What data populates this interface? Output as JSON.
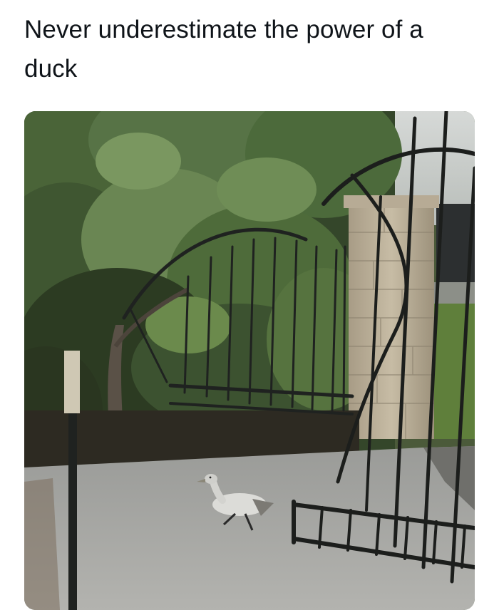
{
  "post": {
    "caption": "Never underestimate the power of a duck"
  },
  "photo": {
    "subject": "duck-walking-past-bent-gate",
    "colors": {
      "sky": "#c9ccc9",
      "foliage_dark": "#2f3f26",
      "foliage_mid": "#4f6a3c",
      "foliage_light": "#7c9a5e",
      "pavement": "#a7a7a4",
      "stone_pillar": "#b9ad96",
      "gate_metal": "#1f2220",
      "duck_body": "#dcdcd8",
      "grass": "#5f7f3b"
    }
  }
}
